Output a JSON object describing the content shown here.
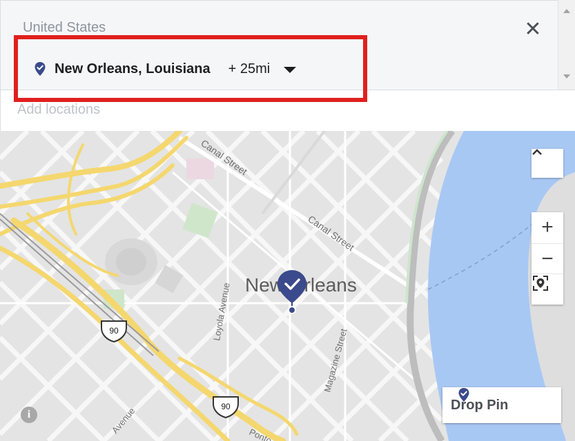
{
  "location_panel": {
    "country": "United States",
    "close_icon": "close-icon",
    "selected_location": {
      "name": "New Orleans, Louisiana",
      "radius": "+ 25mi",
      "pin_icon": "location-pin-icon",
      "dropdown_icon": "caret-down-icon"
    },
    "add_locations_placeholder": "Add locations"
  },
  "map": {
    "city_label": "New Orleans",
    "street_labels": [
      "Canal Street",
      "Canal Street",
      "Loyola Avenue",
      "Magazine Street",
      "Avenue",
      "Ponto"
    ],
    "highway_shields": [
      "90",
      "90"
    ],
    "water_color": "#a8c8f4",
    "highway_color": "#f4d76e",
    "pin_color": "#3b4a8c",
    "controls": {
      "collapse_icon": "chevron-up-icon",
      "zoom_in": "+",
      "zoom_out": "−",
      "locate_icon": "target-pin-icon",
      "info_icon": "info-icon"
    },
    "drop_pin_label": "Drop Pin"
  },
  "highlight_color": "#e0201e"
}
